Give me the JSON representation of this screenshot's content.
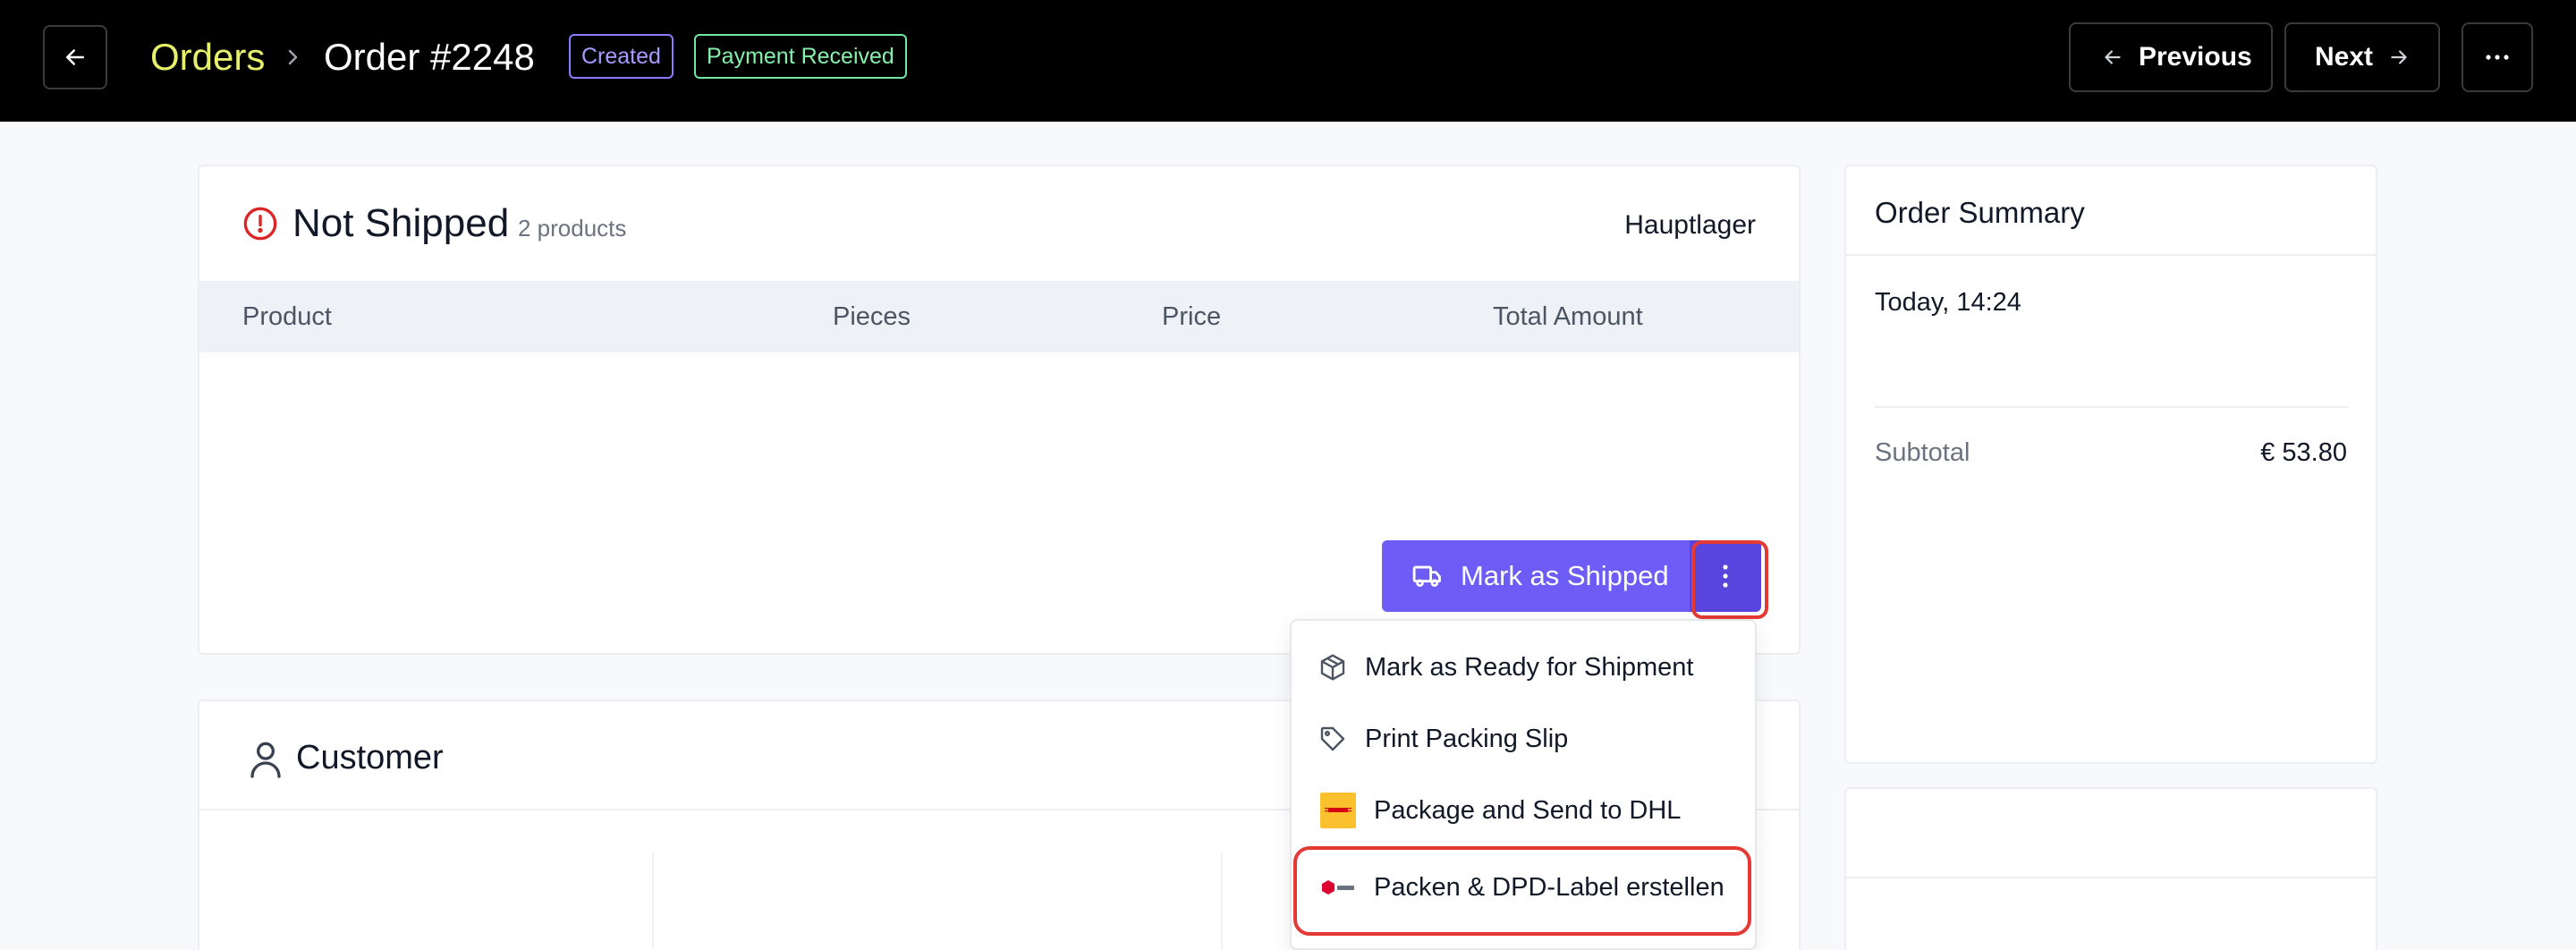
{
  "header": {
    "back_icon": "arrow-left-icon",
    "breadcrumb_root": "Orders",
    "breadcrumb_sep_icon": "chevron-right-icon",
    "breadcrumb_current": "Order #2248",
    "badges": [
      {
        "label": "Created",
        "color": "#8b7cff"
      },
      {
        "label": "Payment Received",
        "color": "#6ee7a0"
      }
    ],
    "previous_label": "Previous",
    "next_label": "Next",
    "more_icon": "ellipsis-icon"
  },
  "shipping_card": {
    "status_icon": "alert-circle-icon",
    "title": "Not Shipped",
    "count": "2 products",
    "warehouse": "Hauptlager",
    "columns": [
      "Product",
      "Pieces",
      "Price",
      "Total Amount"
    ],
    "mark_shipped_label": "Mark as Shipped",
    "truck_icon": "truck-icon",
    "kebab_icon": "vertical-dots-icon",
    "accent": "#6d5cf6"
  },
  "dropdown": {
    "items": [
      {
        "label": "Mark as Ready for Shipment",
        "icon": "package-icon"
      },
      {
        "label": "Print Packing Slip",
        "icon": "tag-icon"
      },
      {
        "label": "Package and Send to DHL",
        "icon": "dhl-logo"
      },
      {
        "label": "Packen & DPD-Label erstellen",
        "icon": "dpd-logo"
      }
    ]
  },
  "customer_card": {
    "icon": "user-icon",
    "title": "Customer"
  },
  "summary": {
    "title": "Order Summary",
    "date": "Today, 14:24",
    "subtotal_label": "Subtotal",
    "subtotal_value": "€ 53.80"
  }
}
